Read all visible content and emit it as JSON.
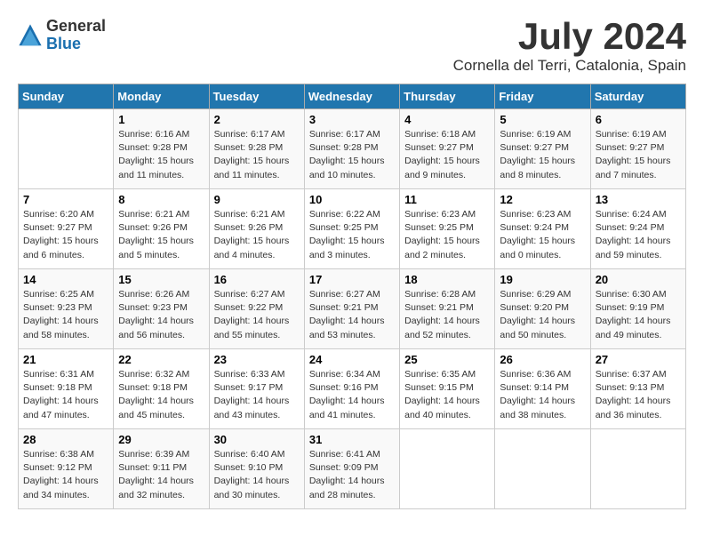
{
  "header": {
    "logo_general": "General",
    "logo_blue": "Blue",
    "month_title": "July 2024",
    "location": "Cornella del Terri, Catalonia, Spain"
  },
  "days_of_week": [
    "Sunday",
    "Monday",
    "Tuesday",
    "Wednesday",
    "Thursday",
    "Friday",
    "Saturday"
  ],
  "weeks": [
    [
      {
        "day": "",
        "info": ""
      },
      {
        "day": "1",
        "info": "Sunrise: 6:16 AM\nSunset: 9:28 PM\nDaylight: 15 hours\nand 11 minutes."
      },
      {
        "day": "2",
        "info": "Sunrise: 6:17 AM\nSunset: 9:28 PM\nDaylight: 15 hours\nand 11 minutes."
      },
      {
        "day": "3",
        "info": "Sunrise: 6:17 AM\nSunset: 9:28 PM\nDaylight: 15 hours\nand 10 minutes."
      },
      {
        "day": "4",
        "info": "Sunrise: 6:18 AM\nSunset: 9:27 PM\nDaylight: 15 hours\nand 9 minutes."
      },
      {
        "day": "5",
        "info": "Sunrise: 6:19 AM\nSunset: 9:27 PM\nDaylight: 15 hours\nand 8 minutes."
      },
      {
        "day": "6",
        "info": "Sunrise: 6:19 AM\nSunset: 9:27 PM\nDaylight: 15 hours\nand 7 minutes."
      }
    ],
    [
      {
        "day": "7",
        "info": "Sunrise: 6:20 AM\nSunset: 9:27 PM\nDaylight: 15 hours\nand 6 minutes."
      },
      {
        "day": "8",
        "info": "Sunrise: 6:21 AM\nSunset: 9:26 PM\nDaylight: 15 hours\nand 5 minutes."
      },
      {
        "day": "9",
        "info": "Sunrise: 6:21 AM\nSunset: 9:26 PM\nDaylight: 15 hours\nand 4 minutes."
      },
      {
        "day": "10",
        "info": "Sunrise: 6:22 AM\nSunset: 9:25 PM\nDaylight: 15 hours\nand 3 minutes."
      },
      {
        "day": "11",
        "info": "Sunrise: 6:23 AM\nSunset: 9:25 PM\nDaylight: 15 hours\nand 2 minutes."
      },
      {
        "day": "12",
        "info": "Sunrise: 6:23 AM\nSunset: 9:24 PM\nDaylight: 15 hours\nand 0 minutes."
      },
      {
        "day": "13",
        "info": "Sunrise: 6:24 AM\nSunset: 9:24 PM\nDaylight: 14 hours\nand 59 minutes."
      }
    ],
    [
      {
        "day": "14",
        "info": "Sunrise: 6:25 AM\nSunset: 9:23 PM\nDaylight: 14 hours\nand 58 minutes."
      },
      {
        "day": "15",
        "info": "Sunrise: 6:26 AM\nSunset: 9:23 PM\nDaylight: 14 hours\nand 56 minutes."
      },
      {
        "day": "16",
        "info": "Sunrise: 6:27 AM\nSunset: 9:22 PM\nDaylight: 14 hours\nand 55 minutes."
      },
      {
        "day": "17",
        "info": "Sunrise: 6:27 AM\nSunset: 9:21 PM\nDaylight: 14 hours\nand 53 minutes."
      },
      {
        "day": "18",
        "info": "Sunrise: 6:28 AM\nSunset: 9:21 PM\nDaylight: 14 hours\nand 52 minutes."
      },
      {
        "day": "19",
        "info": "Sunrise: 6:29 AM\nSunset: 9:20 PM\nDaylight: 14 hours\nand 50 minutes."
      },
      {
        "day": "20",
        "info": "Sunrise: 6:30 AM\nSunset: 9:19 PM\nDaylight: 14 hours\nand 49 minutes."
      }
    ],
    [
      {
        "day": "21",
        "info": "Sunrise: 6:31 AM\nSunset: 9:18 PM\nDaylight: 14 hours\nand 47 minutes."
      },
      {
        "day": "22",
        "info": "Sunrise: 6:32 AM\nSunset: 9:18 PM\nDaylight: 14 hours\nand 45 minutes."
      },
      {
        "day": "23",
        "info": "Sunrise: 6:33 AM\nSunset: 9:17 PM\nDaylight: 14 hours\nand 43 minutes."
      },
      {
        "day": "24",
        "info": "Sunrise: 6:34 AM\nSunset: 9:16 PM\nDaylight: 14 hours\nand 41 minutes."
      },
      {
        "day": "25",
        "info": "Sunrise: 6:35 AM\nSunset: 9:15 PM\nDaylight: 14 hours\nand 40 minutes."
      },
      {
        "day": "26",
        "info": "Sunrise: 6:36 AM\nSunset: 9:14 PM\nDaylight: 14 hours\nand 38 minutes."
      },
      {
        "day": "27",
        "info": "Sunrise: 6:37 AM\nSunset: 9:13 PM\nDaylight: 14 hours\nand 36 minutes."
      }
    ],
    [
      {
        "day": "28",
        "info": "Sunrise: 6:38 AM\nSunset: 9:12 PM\nDaylight: 14 hours\nand 34 minutes."
      },
      {
        "day": "29",
        "info": "Sunrise: 6:39 AM\nSunset: 9:11 PM\nDaylight: 14 hours\nand 32 minutes."
      },
      {
        "day": "30",
        "info": "Sunrise: 6:40 AM\nSunset: 9:10 PM\nDaylight: 14 hours\nand 30 minutes."
      },
      {
        "day": "31",
        "info": "Sunrise: 6:41 AM\nSunset: 9:09 PM\nDaylight: 14 hours\nand 28 minutes."
      },
      {
        "day": "",
        "info": ""
      },
      {
        "day": "",
        "info": ""
      },
      {
        "day": "",
        "info": ""
      }
    ]
  ]
}
